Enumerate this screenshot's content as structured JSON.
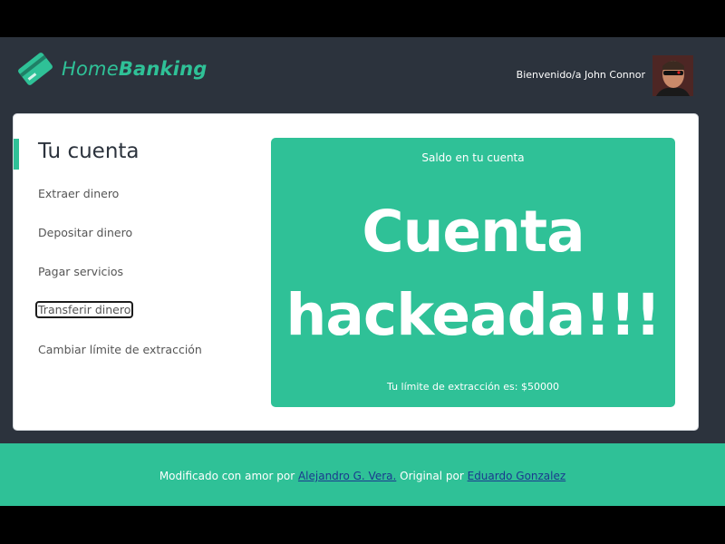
{
  "brand": {
    "name_light": "Home",
    "name_bold": "Banking",
    "color": "#2fc197"
  },
  "header": {
    "welcome": "Bienvenido/a John Connor",
    "avatar_icon": "user-avatar-icon"
  },
  "sidebar": {
    "title": "Tu cuenta",
    "items": [
      {
        "label": "Extraer dinero"
      },
      {
        "label": "Depositar dinero"
      },
      {
        "label": "Pagar servicios"
      },
      {
        "label": "Transferir dinero"
      },
      {
        "label": "Cambiar límite de extracción"
      }
    ]
  },
  "balance": {
    "label": "Saldo en tu cuenta",
    "value_line1": "Cuenta",
    "value_line2": "hackeada!!!",
    "limit_text": "Tu límite de extracción es: $50000"
  },
  "footer": {
    "prefix": "Modificado con amor por ",
    "author_link": "Alejandro G. Vera.",
    "middle": " Original por ",
    "original_link": "Eduardo Gonzalez"
  },
  "colors": {
    "background": "#2c333d",
    "accent": "#2fc197",
    "card": "#ffffff"
  }
}
